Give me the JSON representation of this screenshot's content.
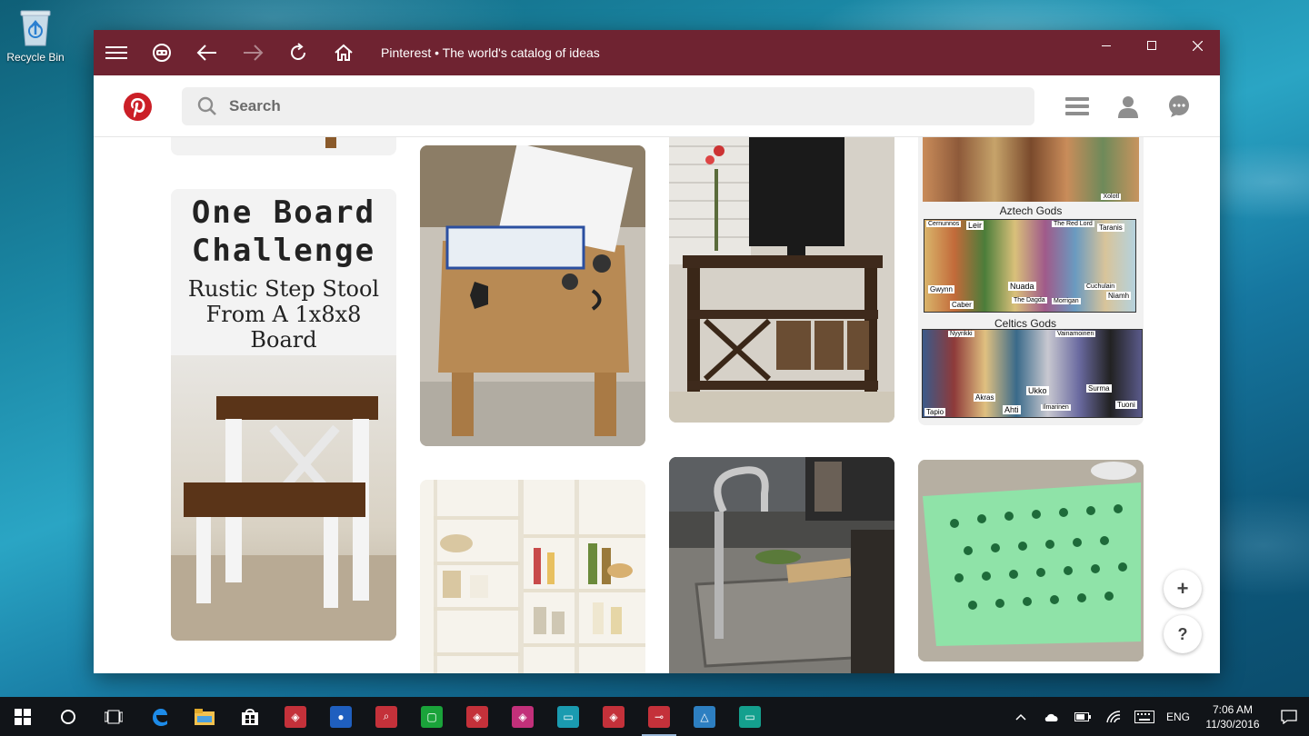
{
  "desktop": {
    "recycle_bin_label": "Recycle Bin"
  },
  "window": {
    "title": "Pinterest • The world's catalog of ideas",
    "titlebar_color": "#6f2331",
    "buttons": [
      "menu-icon",
      "bot-icon",
      "back-arrow-icon",
      "forward-arrow-icon",
      "refresh-icon",
      "home-icon"
    ],
    "controls": [
      "minimize",
      "maximize",
      "close"
    ]
  },
  "appbar": {
    "brand_color": "#cb1f27",
    "search_placeholder": "Search",
    "right_icons": [
      "list-icon",
      "profile-icon",
      "messages-icon"
    ]
  },
  "pins": {
    "step_stool": {
      "line1": "One Board",
      "line2": "Challenge",
      "line3": "Rustic Step Stool",
      "line4": "From A 1x8x8 Board"
    },
    "gods": {
      "caption1": "Aztech Gods",
      "caption2": "Celtics Gods",
      "names_top": [
        "Xolotl"
      ],
      "names_celtic": [
        "Cernunnos",
        "Leir",
        "The Red Lord",
        "Taranis",
        "Nuada",
        "Gwynn",
        "Caber",
        "The Dagda",
        "Morrigan",
        "Cuchulain",
        "Niamh"
      ],
      "names_finnish": [
        "Nyyrikki",
        "Vainamoinen",
        "Akras",
        "Ahti",
        "Ukko",
        "Ilmarinen",
        "Surma",
        "Tapio",
        "Tuoni"
      ]
    }
  },
  "fab": {
    "add": "+",
    "help": "?"
  },
  "taskbar": {
    "apps": [
      {
        "name": "start-icon"
      },
      {
        "name": "cortana-icon"
      },
      {
        "name": "task-view-icon"
      },
      {
        "name": "edge-icon"
      },
      {
        "name": "file-explorer-icon"
      },
      {
        "name": "store-icon"
      },
      {
        "name": "app-red-1",
        "color": "#c4313a"
      },
      {
        "name": "app-drop",
        "color": "#1f5fbf"
      },
      {
        "name": "app-search",
        "color": "#c4313a"
      },
      {
        "name": "app-green",
        "color": "#1aa33a"
      },
      {
        "name": "app-red-2",
        "color": "#c4313a"
      },
      {
        "name": "app-pink",
        "color": "#c2307a"
      },
      {
        "name": "app-teal",
        "color": "#1a9bb0"
      },
      {
        "name": "app-red-3",
        "color": "#c4313a"
      },
      {
        "name": "app-pinterest",
        "color": "#c4313a"
      },
      {
        "name": "app-blue",
        "color": "#2d7fc1"
      },
      {
        "name": "app-teal-2",
        "color": "#14a08e"
      }
    ],
    "tray": {
      "language": "ENG",
      "time": "7:06 AM",
      "date": "11/30/2016"
    }
  }
}
